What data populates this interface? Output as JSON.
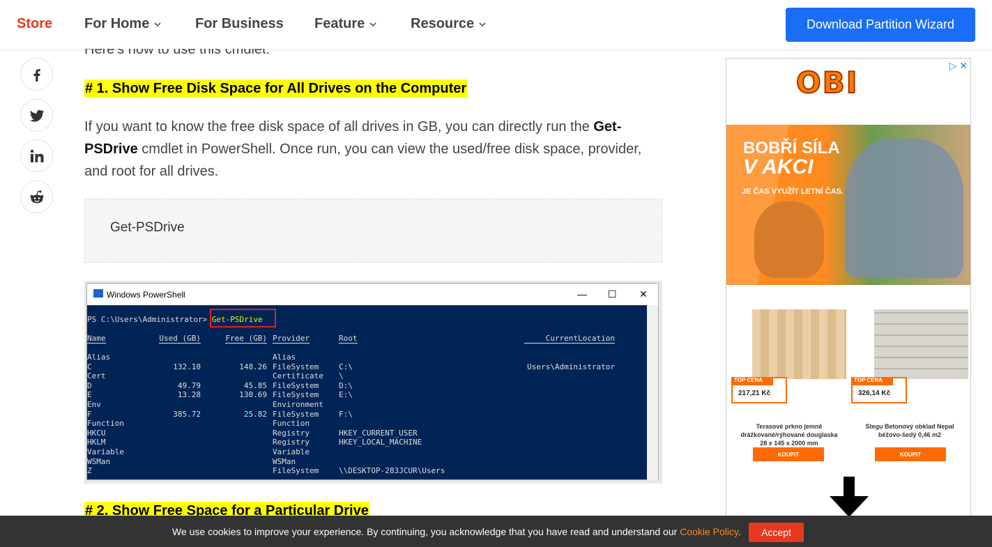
{
  "header": {
    "logo": "Store",
    "nav": [
      {
        "label": "For Home",
        "dropdown": true
      },
      {
        "label": "For Business",
        "dropdown": false
      },
      {
        "label": "Feature",
        "dropdown": true
      },
      {
        "label": "Resource",
        "dropdown": true
      }
    ],
    "download_label": "Download Partition Wizard"
  },
  "article": {
    "partial_line": "Here's how to use this cmdlet:",
    "section1_heading": "# 1. Show Free Disk Space for All Drives on the Computer",
    "para_part1": "If you want to know the free disk space of all drives in GB, you can directly run the ",
    "para_bold": "Get-PSDrive",
    "para_part2": " cmdlet in PowerShell. Once run, you can view the used/free disk space, provider, and root for all drives.",
    "code": "Get-PSDrive",
    "section2_heading": "# 2. Show Free Space for a Particular Drive"
  },
  "share": [
    "facebook-icon",
    "twitter-icon",
    "linkedin-icon",
    "reddit-icon"
  ],
  "powershell": {
    "title": "Windows PowerShell",
    "prompt": "PS C:\\Users\\Administrator> ",
    "command": "Get-PSDrive",
    "headers": {
      "name": "Name",
      "used": "Used (GB)",
      "free": "Free (GB)",
      "provider": "Provider",
      "root": "Root",
      "current": "CurrentLocation"
    },
    "rows": [
      {
        "name": "Alias",
        "used": "",
        "free": "",
        "provider": "Alias",
        "root": "",
        "current": ""
      },
      {
        "name": "C",
        "used": "132.10",
        "free": "148.26",
        "provider": "FileSystem",
        "root": "C:\\",
        "current": "Users\\Administrator"
      },
      {
        "name": "Cert",
        "used": "",
        "free": "",
        "provider": "Certificate",
        "root": "\\",
        "current": ""
      },
      {
        "name": "D",
        "used": "49.79",
        "free": "45.85",
        "provider": "FileSystem",
        "root": "D:\\",
        "current": ""
      },
      {
        "name": "E",
        "used": "13.28",
        "free": "130.69",
        "provider": "FileSystem",
        "root": "E:\\",
        "current": ""
      },
      {
        "name": "Env",
        "used": "",
        "free": "",
        "provider": "Environment",
        "root": "",
        "current": ""
      },
      {
        "name": "F",
        "used": "385.72",
        "free": "25.82",
        "provider": "FileSystem",
        "root": "F:\\",
        "current": ""
      },
      {
        "name": "Function",
        "used": "",
        "free": "",
        "provider": "Function",
        "root": "",
        "current": ""
      },
      {
        "name": "HKCU",
        "used": "",
        "free": "",
        "provider": "Registry",
        "root": "HKEY_CURRENT_USER",
        "current": ""
      },
      {
        "name": "HKLM",
        "used": "",
        "free": "",
        "provider": "Registry",
        "root": "HKEY_LOCAL_MACHINE",
        "current": ""
      },
      {
        "name": "Variable",
        "used": "",
        "free": "",
        "provider": "Variable",
        "root": "",
        "current": ""
      },
      {
        "name": "WSMan",
        "used": "",
        "free": "",
        "provider": "WSMan",
        "root": "",
        "current": ""
      },
      {
        "name": "Z",
        "used": "",
        "free": "",
        "provider": "FileSystem",
        "root": "\\\\DESKTOP-283JCUR\\Users",
        "current": ""
      }
    ]
  },
  "ad": {
    "brand": "OBI",
    "banner_line1": "BOBŘÍ SÍLA",
    "banner_line2": "V AKCI",
    "banner_line3": "JE ČAS VYUŽÍT LETNÍ ČAS.",
    "products": [
      {
        "tag": "TOP CENA",
        "price": "217,21 Kč",
        "desc": "Terasové prkno jemně drážkované/rýhované douglaska 28 x 145 x 2000 mm",
        "buy": "KOUPIT"
      },
      {
        "tag": "TOP CENA",
        "price": "326,14 Kč",
        "desc": "Stegu Betonový obklad Nepal béžovo-šedý 0,46 m2",
        "buy": "KOUPIT"
      }
    ]
  },
  "cookie": {
    "text": "We use cookies to improve your experience. By continuing, you acknowledge that you have read and understand our ",
    "link": "Cookie Policy",
    "end": ".",
    "accept": "Accept"
  }
}
